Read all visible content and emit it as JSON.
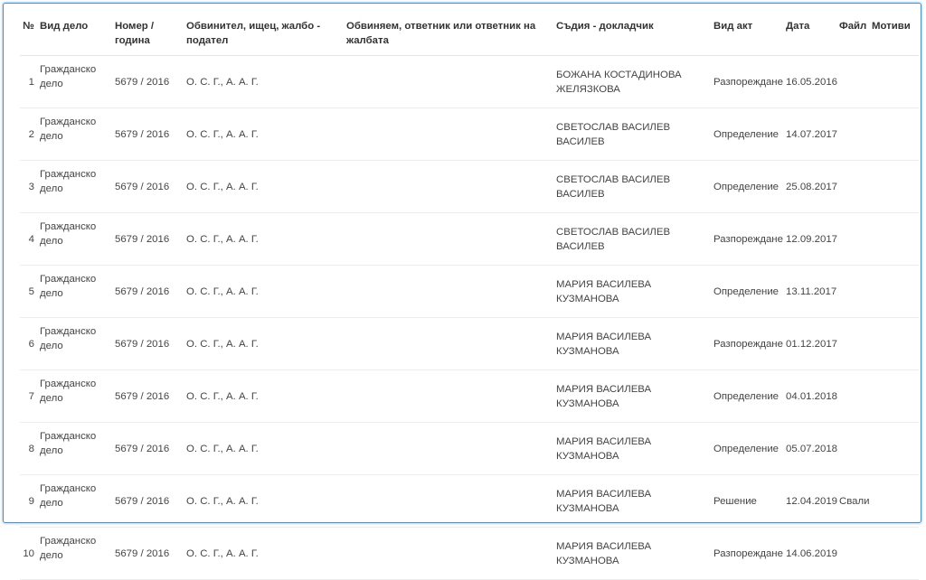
{
  "headers": {
    "num": "№",
    "case_type": "Вид дело",
    "number_year": "Номер / година",
    "accuser": "Обвинител, ищец, жалбо - подател",
    "accused": "Обвиняем, ответник или ответник на жалбата",
    "judge": "Съдия - докладчик",
    "act_type": "Вид акт",
    "date": "Дата",
    "file": "Файл",
    "motives": "Мотиви"
  },
  "rows": [
    {
      "num": "1",
      "case_type": "Гражданско дело",
      "number_year": "5679 / 2016",
      "accuser": "О. С. Г., А. А. Г.",
      "accused": "",
      "judge": "БОЖАНА КОСТАДИНОВА ЖЕЛЯЗКОВА",
      "act_type": "Разпореждане",
      "date": "16.05.2016",
      "file": "",
      "motives": ""
    },
    {
      "num": "2",
      "case_type": "Гражданско дело",
      "number_year": "5679 / 2016",
      "accuser": "О. С. Г., А. А. Г.",
      "accused": "",
      "judge": "СВЕТОСЛАВ ВАСИЛЕВ ВАСИЛЕВ",
      "act_type": "Определение",
      "date": "14.07.2017",
      "file": "",
      "motives": ""
    },
    {
      "num": "3",
      "case_type": "Гражданско дело",
      "number_year": "5679 / 2016",
      "accuser": "О. С. Г., А. А. Г.",
      "accused": "",
      "judge": "СВЕТОСЛАВ ВАСИЛЕВ ВАСИЛЕВ",
      "act_type": "Определение",
      "date": "25.08.2017",
      "file": "",
      "motives": ""
    },
    {
      "num": "4",
      "case_type": "Гражданско дело",
      "number_year": "5679 / 2016",
      "accuser": "О. С. Г., А. А. Г.",
      "accused": "",
      "judge": "СВЕТОСЛАВ ВАСИЛЕВ ВАСИЛЕВ",
      "act_type": "Разпореждане",
      "date": "12.09.2017",
      "file": "",
      "motives": ""
    },
    {
      "num": "5",
      "case_type": "Гражданско дело",
      "number_year": "5679 / 2016",
      "accuser": "О. С. Г., А. А. Г.",
      "accused": "",
      "judge": "МАРИЯ ВАСИЛЕВА КУЗМАНОВА",
      "act_type": "Определение",
      "date": "13.11.2017",
      "file": "",
      "motives": ""
    },
    {
      "num": "6",
      "case_type": "Гражданско дело",
      "number_year": "5679 / 2016",
      "accuser": "О. С. Г., А. А. Г.",
      "accused": "",
      "judge": "МАРИЯ ВАСИЛЕВА КУЗМАНОВА",
      "act_type": "Разпореждане",
      "date": "01.12.2017",
      "file": "",
      "motives": ""
    },
    {
      "num": "7",
      "case_type": "Гражданско дело",
      "number_year": "5679 / 2016",
      "accuser": "О. С. Г., А. А. Г.",
      "accused": "",
      "judge": "МАРИЯ ВАСИЛЕВА КУЗМАНОВА",
      "act_type": "Определение",
      "date": "04.01.2018",
      "file": "",
      "motives": ""
    },
    {
      "num": "8",
      "case_type": "Гражданско дело",
      "number_year": "5679 / 2016",
      "accuser": "О. С. Г., А. А. Г.",
      "accused": "",
      "judge": "МАРИЯ ВАСИЛЕВА КУЗМАНОВА",
      "act_type": "Определение",
      "date": "05.07.2018",
      "file": "",
      "motives": ""
    },
    {
      "num": "9",
      "case_type": "Гражданско дело",
      "number_year": "5679 / 2016",
      "accuser": "О. С. Г., А. А. Г.",
      "accused": "",
      "judge": "МАРИЯ ВАСИЛЕВА КУЗМАНОВА",
      "act_type": "Решение",
      "date": "12.04.2019",
      "file": "Свали",
      "motives": ""
    },
    {
      "num": "10",
      "case_type": "Гражданско дело",
      "number_year": "5679 / 2016",
      "accuser": "О. С. Г., А. А. Г.",
      "accused": "",
      "judge": "МАРИЯ ВАСИЛЕВА КУЗМАНОВА",
      "act_type": "Разпореждане",
      "date": "14.06.2019",
      "file": "",
      "motives": ""
    }
  ]
}
